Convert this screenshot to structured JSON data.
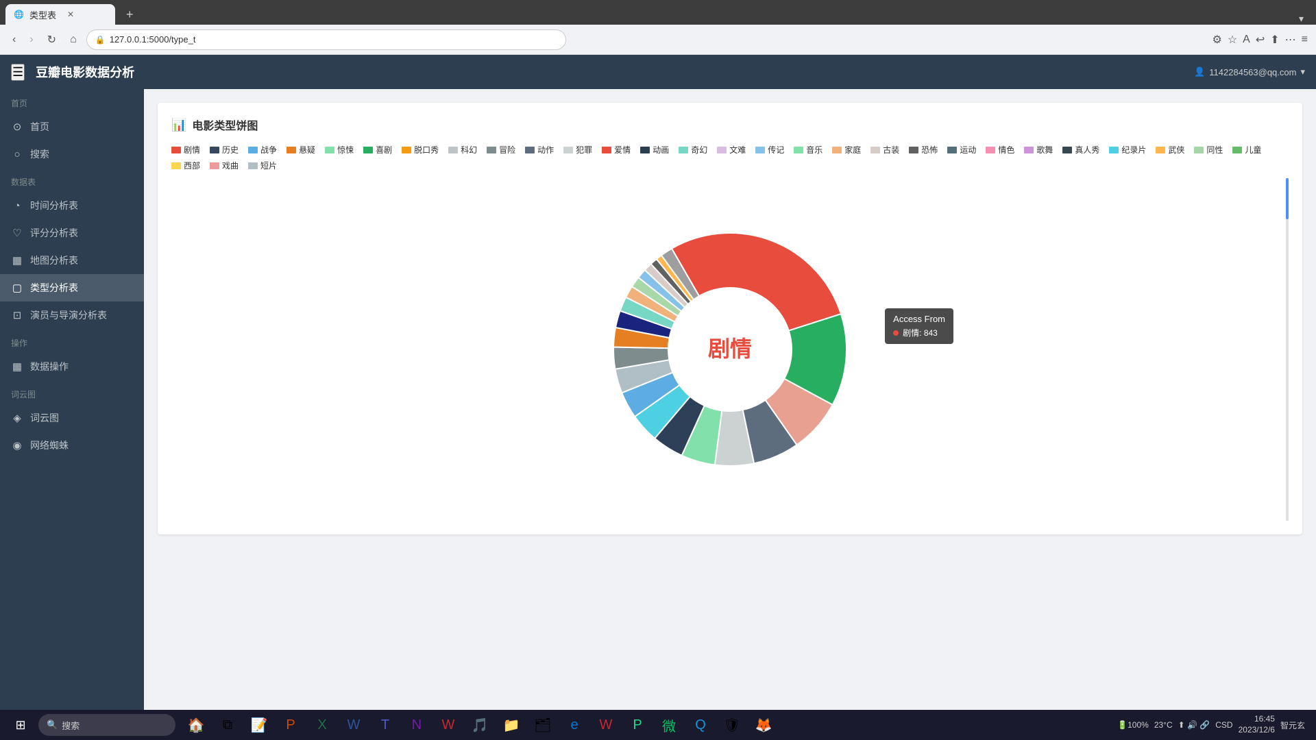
{
  "browser": {
    "tab_title": "类型表",
    "url": "127.0.0.1:5000/type_t",
    "new_tab_label": "+",
    "tab_list_icon": "▾"
  },
  "header": {
    "app_title": "豆瓣电影数据分析",
    "user_email": "1142284563@qq.com",
    "hamburger_icon": "☰",
    "user_icon": "👤"
  },
  "sidebar": {
    "sections": [
      {
        "label": "首页",
        "items": [
          {
            "id": "home",
            "icon": "⊙",
            "label": "首页"
          },
          {
            "id": "search",
            "icon": "○",
            "label": "搜索"
          }
        ]
      },
      {
        "label": "数据表",
        "items": [
          {
            "id": "time-analysis",
            "icon": "◔",
            "label": "时间分析表"
          },
          {
            "id": "score-analysis",
            "icon": "♡",
            "label": "评分分析表"
          },
          {
            "id": "map-analysis",
            "icon": "▦",
            "label": "地图分析表"
          },
          {
            "id": "type-analysis",
            "icon": "▢",
            "label": "类型分析表",
            "active": true
          },
          {
            "id": "actor-director",
            "icon": "⊡",
            "label": "演员与导演分析表"
          }
        ]
      },
      {
        "label": "操作",
        "items": [
          {
            "id": "data-ops",
            "icon": "▦",
            "label": "数据操作"
          }
        ]
      },
      {
        "label": "词云图",
        "items": [
          {
            "id": "wordcloud",
            "icon": "◈",
            "label": "词云图"
          }
        ]
      },
      {
        "label": "",
        "items": [
          {
            "id": "spider",
            "icon": "◉",
            "label": "网络蜘蛛"
          }
        ]
      }
    ]
  },
  "chart": {
    "title": "电影类型饼图",
    "title_icon": "📊",
    "center_text": "剧情",
    "tooltip": {
      "title": "Access From",
      "item_label": "剧情",
      "item_value": "843"
    },
    "legend": [
      {
        "label": "剧情",
        "color": "#e74c3c"
      },
      {
        "label": "历史",
        "color": "#34495e"
      },
      {
        "label": "战争",
        "color": "#5dade2"
      },
      {
        "label": "悬疑",
        "color": "#e67e22"
      },
      {
        "label": "惊悚",
        "color": "#82e0aa"
      },
      {
        "label": "喜剧",
        "color": "#27ae60"
      },
      {
        "label": "脱口秀",
        "color": "#f39c12"
      },
      {
        "label": "科幻",
        "color": "#bdc3c7"
      },
      {
        "label": "冒险",
        "color": "#7f8c8d"
      },
      {
        "label": "动作",
        "color": "#5d6d7e"
      },
      {
        "label": "犯罪",
        "color": "#ccd1d1"
      },
      {
        "label": "爱情",
        "color": "#e74c3c"
      },
      {
        "label": "动画",
        "color": "#2c3e50"
      },
      {
        "label": "奇幻",
        "color": "#76d7c4"
      },
      {
        "label": "文难",
        "color": "#d7bde2"
      },
      {
        "label": "传记",
        "color": "#85c1e9"
      },
      {
        "label": "音乐",
        "color": "#82e0aa"
      },
      {
        "label": "家庭",
        "color": "#f0b27a"
      },
      {
        "label": "古装",
        "color": "#d7ccc8"
      },
      {
        "label": "恐怖",
        "color": "#616161"
      },
      {
        "label": "运动",
        "color": "#546e7a"
      },
      {
        "label": "情色",
        "color": "#f48fb1"
      },
      {
        "label": "歌舞",
        "color": "#ce93d8"
      },
      {
        "label": "真人秀",
        "color": "#37474f"
      },
      {
        "label": "纪录片",
        "color": "#4dd0e1"
      },
      {
        "label": "武侠",
        "color": "#ffb74d"
      },
      {
        "label": "同性",
        "color": "#a5d6a7"
      },
      {
        "label": "儿童",
        "color": "#66bb6a"
      },
      {
        "label": "西部",
        "color": "#ffd54f"
      },
      {
        "label": "戏曲",
        "color": "#ef9a9a"
      },
      {
        "label": "短片",
        "color": "#b0bec5"
      }
    ],
    "segments": [
      {
        "label": "剧情",
        "value": 843,
        "color": "#e74c3c",
        "startAngle": -30,
        "endAngle": 105
      },
      {
        "label": "喜剧",
        "value": 380,
        "color": "#27ae60",
        "startAngle": 105,
        "endAngle": 163
      },
      {
        "label": "爱情",
        "value": 220,
        "color": "#e8a090",
        "startAngle": 163,
        "endAngle": 196
      },
      {
        "label": "动作",
        "value": 190,
        "color": "#5d6d7e",
        "startAngle": 196,
        "endAngle": 224
      },
      {
        "label": "犯罪",
        "value": 160,
        "color": "#ccd1d1",
        "startAngle": 224,
        "endAngle": 248
      },
      {
        "label": "惊悚",
        "value": 140,
        "color": "#82e0aa",
        "startAngle": 248,
        "endAngle": 268
      },
      {
        "label": "历史",
        "value": 130,
        "color": "#34495e",
        "startAngle": 268,
        "endAngle": 287
      },
      {
        "label": "纪录片",
        "value": 120,
        "color": "#4dd0e1",
        "startAngle": 287,
        "endAngle": 304
      },
      {
        "label": "战争",
        "value": 110,
        "color": "#5dade2",
        "startAngle": 304,
        "endAngle": 320
      },
      {
        "label": "科幻",
        "value": 100,
        "color": "#bdc3c7",
        "startAngle": 320,
        "endAngle": 334
      },
      {
        "label": "冒险",
        "value": 90,
        "color": "#7f8c8d",
        "startAngle": 334,
        "endAngle": 347
      },
      {
        "label": "悬疑",
        "value": 80,
        "color": "#e67e22",
        "startAngle": 347,
        "endAngle": 355
      },
      {
        "label": "动画",
        "value": 70,
        "color": "#2c3e50",
        "startAngle": 355,
        "endAngle": 364
      },
      {
        "label": "奇幻",
        "value": 60,
        "color": "#76d7c4",
        "startAngle": -20,
        "endAngle": -12
      },
      {
        "label": "家庭",
        "value": 50,
        "color": "#f0b27a",
        "startAngle": -12,
        "endAngle": -5
      },
      {
        "label": "音乐",
        "value": 45,
        "color": "#82e0aa",
        "startAngle": -5,
        "endAngle": 2
      }
    ]
  },
  "taskbar": {
    "search_placeholder": "搜索",
    "time": "16:45",
    "date": "2023/12/6",
    "temperature": "23°C",
    "ai_label": "智元玄"
  }
}
